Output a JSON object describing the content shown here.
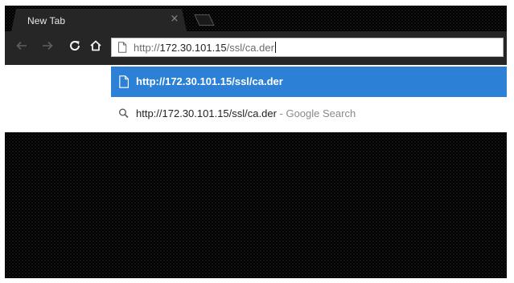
{
  "tab": {
    "title": "New Tab",
    "close_glyph": "×"
  },
  "toolbar": {
    "back_icon": "back-arrow-icon",
    "forward_icon": "forward-arrow-icon",
    "reload_icon": "reload-icon",
    "home_icon": "home-icon"
  },
  "omnibox": {
    "scheme": "http://",
    "host": "172.30.101.15",
    "path": "/ssl/ca.der",
    "icon": "page-icon"
  },
  "suggestions": [
    {
      "type": "url",
      "icon": "page-icon",
      "text": "http://172.30.101.15/ssl/ca.der",
      "selected": true
    },
    {
      "type": "search",
      "icon": "search-icon",
      "text": "http://172.30.101.15/ssl/ca.der",
      "suffix": " - Google Search",
      "selected": false
    }
  ],
  "colors": {
    "selection": "#2c81d6",
    "chrome_dark": "#262626",
    "background": "#000000"
  }
}
